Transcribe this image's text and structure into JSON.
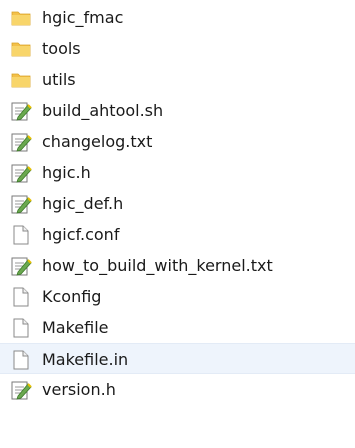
{
  "files": [
    {
      "name": "hgic_fmac",
      "icon": "folder-icon"
    },
    {
      "name": "tools",
      "icon": "folder-icon"
    },
    {
      "name": "utils",
      "icon": "folder-icon"
    },
    {
      "name": "build_ahtool.sh",
      "icon": "text-document-icon"
    },
    {
      "name": "changelog.txt",
      "icon": "text-document-icon"
    },
    {
      "name": "hgic.h",
      "icon": "text-document-icon"
    },
    {
      "name": "hgic_def.h",
      "icon": "text-document-icon"
    },
    {
      "name": "hgicf.conf",
      "icon": "blank-file-icon"
    },
    {
      "name": "how_to_build_with_kernel.txt",
      "icon": "text-document-icon"
    },
    {
      "name": "Kconfig",
      "icon": "blank-file-icon"
    },
    {
      "name": "Makefile",
      "icon": "blank-file-icon"
    },
    {
      "name": "Makefile.in",
      "icon": "blank-file-icon"
    },
    {
      "name": "version.h",
      "icon": "text-document-icon"
    }
  ],
  "selected_file": "Makefile.in",
  "colors": {
    "folder": "#f5c542",
    "selection_background": "#eef4fc",
    "text": "#1a1a1a"
  }
}
